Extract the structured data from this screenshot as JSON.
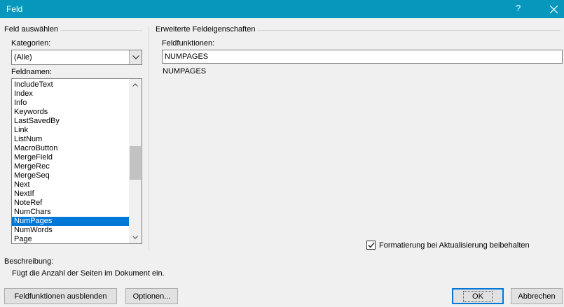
{
  "window": {
    "title": "Feld",
    "help": "?"
  },
  "left": {
    "group_title": "Feld auswählen",
    "categories_label": "Kategorien:",
    "category_value": "(Alle)",
    "fieldnames_label": "Feldnamen:",
    "fieldnames": [
      "IncludeText",
      "Index",
      "Info",
      "Keywords",
      "LastSavedBy",
      "Link",
      "ListNum",
      "MacroButton",
      "MergeField",
      "MergeRec",
      "MergeSeq",
      "Next",
      "NextIf",
      "NoteRef",
      "NumChars",
      "NumPages",
      "NumWords",
      "Page"
    ],
    "selected_field": "NumPages"
  },
  "right": {
    "group_title": "Erweiterte Feldeigenschaften",
    "field_codes_label": "Feldfunktionen:",
    "field_code_value": "NUMPAGES",
    "syntax_text": "NUMPAGES",
    "preserve_format_label": "Formatierung bei Aktualisierung beibehalten",
    "preserve_format_checked": true
  },
  "description": {
    "label": "Beschreibung:",
    "text": "Fügt die Anzahl der Seiten im Dokument ein."
  },
  "buttons": {
    "hide_codes": "Feldfunktionen ausblenden",
    "options": "Optionen...",
    "ok": "OK",
    "cancel": "Abbrechen"
  }
}
